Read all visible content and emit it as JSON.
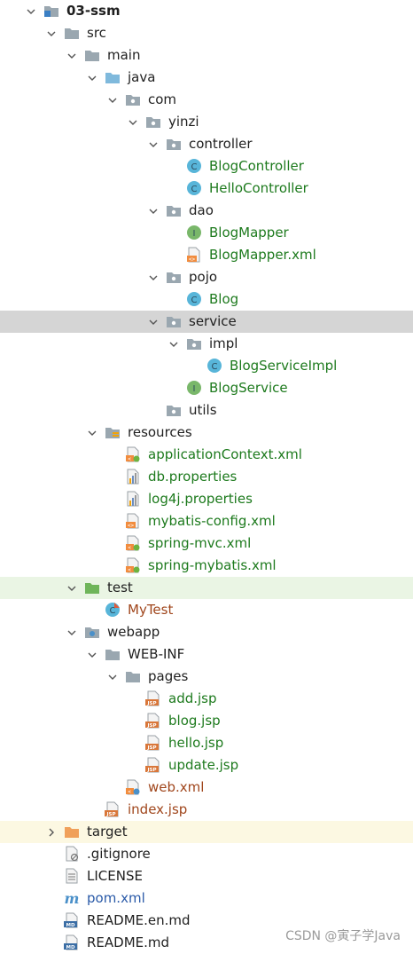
{
  "project_tree": {
    "nodes": [
      {
        "label": "03-ssm",
        "depth": 0,
        "arrow": "down",
        "icon": "module-folder-icon",
        "color": "dark",
        "bold": true
      },
      {
        "label": "src",
        "depth": 1,
        "arrow": "down",
        "icon": "folder-icon",
        "color": "dark"
      },
      {
        "label": "main",
        "depth": 2,
        "arrow": "down",
        "icon": "folder-icon",
        "color": "dark"
      },
      {
        "label": "java",
        "depth": 3,
        "arrow": "down",
        "icon": "source-root-folder-icon",
        "color": "dark"
      },
      {
        "label": "com",
        "depth": 4,
        "arrow": "down",
        "icon": "package-icon",
        "color": "dark"
      },
      {
        "label": "yinzi",
        "depth": 5,
        "arrow": "down",
        "icon": "package-icon",
        "color": "dark"
      },
      {
        "label": "controller",
        "depth": 6,
        "arrow": "down",
        "icon": "package-icon",
        "color": "dark"
      },
      {
        "label": "BlogController",
        "depth": 7,
        "arrow": "none",
        "icon": "java-class-icon",
        "color": "green"
      },
      {
        "label": "HelloController",
        "depth": 7,
        "arrow": "none",
        "icon": "java-class-icon",
        "color": "green"
      },
      {
        "label": "dao",
        "depth": 6,
        "arrow": "down",
        "icon": "package-icon",
        "color": "dark"
      },
      {
        "label": "BlogMapper",
        "depth": 7,
        "arrow": "none",
        "icon": "java-interface-icon",
        "color": "green"
      },
      {
        "label": "BlogMapper.xml",
        "depth": 7,
        "arrow": "none",
        "icon": "xml-file-icon",
        "color": "green"
      },
      {
        "label": "pojo",
        "depth": 6,
        "arrow": "down",
        "icon": "package-icon",
        "color": "dark"
      },
      {
        "label": "Blog",
        "depth": 7,
        "arrow": "none",
        "icon": "java-class-icon",
        "color": "green"
      },
      {
        "label": "service",
        "depth": 6,
        "arrow": "down",
        "icon": "package-icon",
        "color": "dark",
        "selected": true
      },
      {
        "label": "impl",
        "depth": 7,
        "arrow": "down",
        "icon": "package-icon",
        "color": "dark"
      },
      {
        "label": "BlogServiceImpl",
        "depth": 8,
        "arrow": "none",
        "icon": "java-class-icon",
        "color": "green"
      },
      {
        "label": "BlogService",
        "depth": 7,
        "arrow": "none",
        "icon": "java-interface-icon",
        "color": "green"
      },
      {
        "label": "utils",
        "depth": 6,
        "arrow": "none",
        "icon": "package-icon",
        "color": "dark"
      },
      {
        "label": "resources",
        "depth": 3,
        "arrow": "down",
        "icon": "resources-folder-icon",
        "color": "dark"
      },
      {
        "label": "applicationContext.xml",
        "depth": 4,
        "arrow": "none",
        "icon": "spring-xml-icon",
        "color": "green"
      },
      {
        "label": "db.properties",
        "depth": 4,
        "arrow": "none",
        "icon": "properties-file-icon",
        "color": "green"
      },
      {
        "label": "log4j.properties",
        "depth": 4,
        "arrow": "none",
        "icon": "properties-file-icon",
        "color": "green"
      },
      {
        "label": "mybatis-config.xml",
        "depth": 4,
        "arrow": "none",
        "icon": "xml-file-icon",
        "color": "green"
      },
      {
        "label": "spring-mvc.xml",
        "depth": 4,
        "arrow": "none",
        "icon": "spring-xml-icon",
        "color": "green"
      },
      {
        "label": "spring-mybatis.xml",
        "depth": 4,
        "arrow": "none",
        "icon": "spring-xml-icon",
        "color": "green"
      },
      {
        "label": "test",
        "depth": 2,
        "arrow": "down",
        "icon": "test-folder-icon",
        "color": "dark",
        "highlight": "green"
      },
      {
        "label": "MyTest",
        "depth": 3,
        "arrow": "none",
        "icon": "test-class-icon",
        "color": "brown"
      },
      {
        "label": "webapp",
        "depth": 2,
        "arrow": "down",
        "icon": "web-folder-icon",
        "color": "dark"
      },
      {
        "label": "WEB-INF",
        "depth": 3,
        "arrow": "down",
        "icon": "folder-icon",
        "color": "dark"
      },
      {
        "label": "pages",
        "depth": 4,
        "arrow": "down",
        "icon": "folder-icon",
        "color": "dark"
      },
      {
        "label": "add.jsp",
        "depth": 5,
        "arrow": "none",
        "icon": "jsp-file-icon",
        "color": "green"
      },
      {
        "label": "blog.jsp",
        "depth": 5,
        "arrow": "none",
        "icon": "jsp-file-icon",
        "color": "green"
      },
      {
        "label": "hello.jsp",
        "depth": 5,
        "arrow": "none",
        "icon": "jsp-file-icon",
        "color": "green"
      },
      {
        "label": "update.jsp",
        "depth": 5,
        "arrow": "none",
        "icon": "jsp-file-icon",
        "color": "green"
      },
      {
        "label": "web.xml",
        "depth": 4,
        "arrow": "none",
        "icon": "web-xml-icon",
        "color": "brown"
      },
      {
        "label": "index.jsp",
        "depth": 3,
        "arrow": "none",
        "icon": "jsp-file-icon",
        "color": "brown"
      },
      {
        "label": "target",
        "depth": 1,
        "arrow": "right",
        "icon": "excluded-folder-icon",
        "color": "dark",
        "highlight": "yellow"
      },
      {
        "label": ".gitignore",
        "depth": 1,
        "arrow": "none",
        "icon": "ignored-file-icon",
        "color": "dark"
      },
      {
        "label": "LICENSE",
        "depth": 1,
        "arrow": "none",
        "icon": "text-file-icon",
        "color": "dark"
      },
      {
        "label": "pom.xml",
        "depth": 1,
        "arrow": "none",
        "icon": "maven-icon",
        "color": "blue"
      },
      {
        "label": "README.en.md",
        "depth": 1,
        "arrow": "none",
        "icon": "markdown-file-icon",
        "color": "dark"
      },
      {
        "label": "README.md",
        "depth": 1,
        "arrow": "none",
        "icon": "markdown-file-icon",
        "color": "dark"
      }
    ]
  },
  "watermark": {
    "text": "CSDN @寅子学Java"
  },
  "colors": {
    "selected_row": "#d5d5d5",
    "test_row": "#eaf5e4",
    "excluded_row": "#fcf8e2",
    "class_icon": "#58b5d9",
    "interface_icon": "#79b76a",
    "folder": "#9aa7b0"
  }
}
